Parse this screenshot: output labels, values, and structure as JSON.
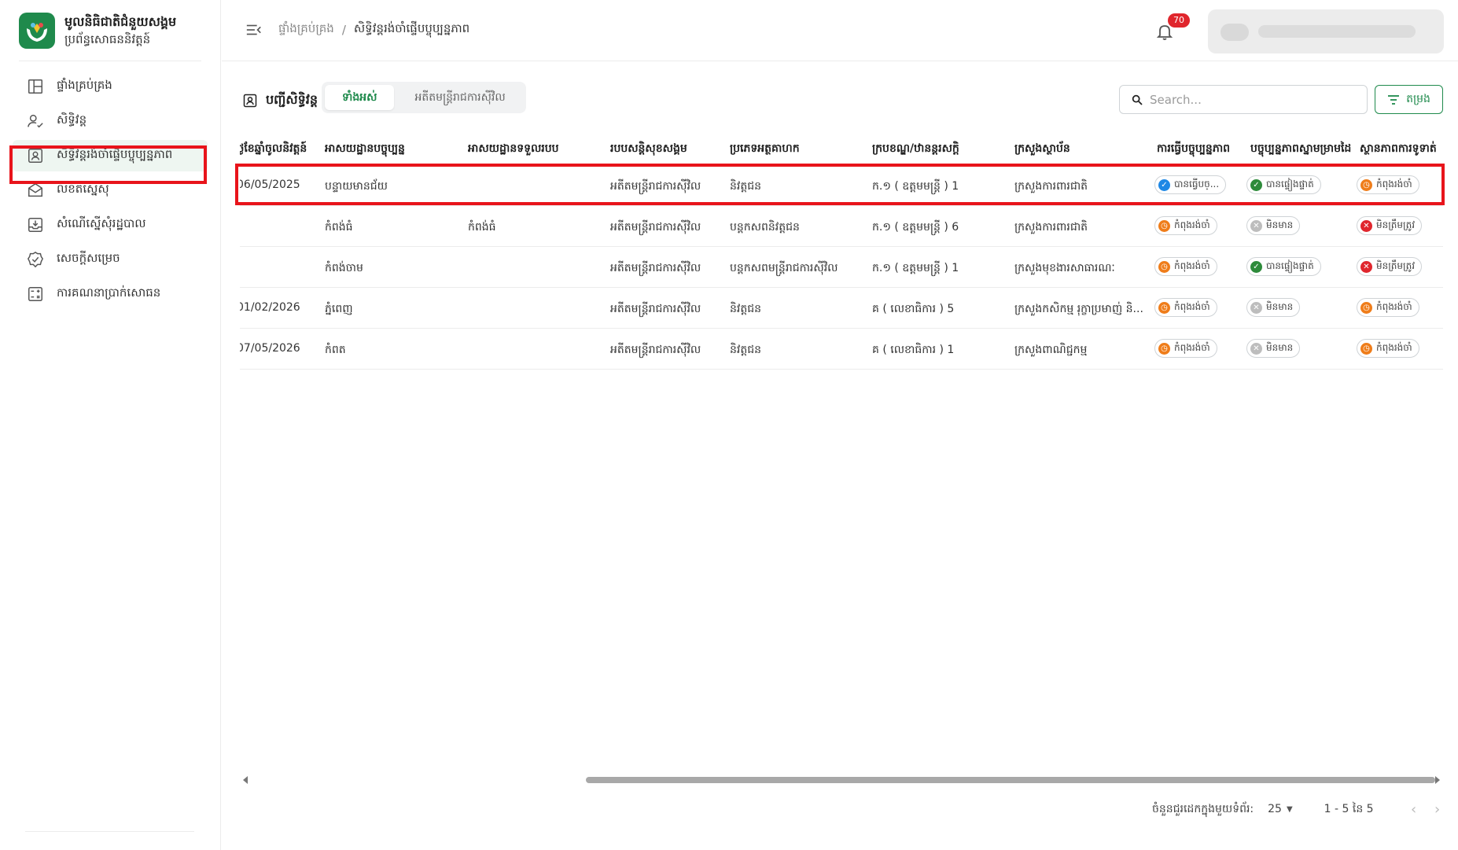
{
  "brand": {
    "title": "មូលនិធិជាតិជំនួយសង្គម",
    "subtitle": "ប្រព័ន្ធសោធននិវត្តន៍"
  },
  "sidebar": {
    "items": [
      {
        "label": "ផ្ទាំងគ្រប់គ្រង",
        "icon": "dashboard-icon"
      },
      {
        "label": "សិទ្ធិវន្ត",
        "icon": "user-check-icon"
      },
      {
        "label": "សិទ្ធិវន្តរង់ចាំផ្ទើបប្ចុប្បន្នភាព",
        "icon": "profile-card-icon"
      },
      {
        "label": "លិខិតស្នើសុំ",
        "icon": "envelope-icon"
      },
      {
        "label": "សំណើស្នើសុំរដ្ឋបាល",
        "icon": "download-tray-icon"
      },
      {
        "label": "សេចក្តីសម្រេច",
        "icon": "verified-badge-icon"
      },
      {
        "label": "ការគណនាប្រាក់សោធន",
        "icon": "calculator-icon"
      }
    ],
    "active_index": 2
  },
  "header": {
    "breadcrumb_home": "ផ្ទាំងគ្រប់គ្រង",
    "breadcrumb_sep": "/",
    "breadcrumb_current": "សិទ្ធិវន្តរង់ចាំផ្ទើបប្ចុប្បន្នភាព",
    "notification_count": "70"
  },
  "toolbar": {
    "list_title": "បញ្ជីសិទ្ធិវន្ត",
    "tabs": [
      "ទាំងអស់",
      "អតីតមន្ត្រីរាជការស៊ីវិល"
    ],
    "active_tab": 0,
    "search_placeholder": "Search...",
    "filter_label": "តម្រង"
  },
  "table": {
    "columns": [
      "ថ្ងៃខែឆ្នាំចូលនិវត្តន៍",
      "អាសយដ្ឋានបច្ចុប្បន្ន",
      "អាសយដ្ឋានទទួលរបប",
      "របបសន្តិសុខសង្គម",
      "ប្រភេទអត្ថគាហក",
      "ក្របខណ្ឌ/ឋានន្តរសក្តិ",
      "ក្រសួងស្ថាប័ន",
      "ការធ្វើបច្ចុប្បន្នភាព",
      "បច្ចុប្បន្នភាពស្នាមម្រាមដៃ",
      "ស្ថានភាពការទូទាត់"
    ],
    "rows": [
      {
        "retire_date": "06/05/2025",
        "current_address": "បន្ទាយមានជ័យ",
        "receive_address": "",
        "scheme": "អតីតមន្ត្រីរាជការស៊ីវិល",
        "type": "និវត្តជន",
        "rank": "ក.១ ( ឧត្តមមន្ត្រី ) 1",
        "ministry": "ក្រសួងការពារជាតិ",
        "update": {
          "label": "បានធ្វើបច្...",
          "status": "blue"
        },
        "fingerprint": {
          "label": "បានផ្ទៀងផ្ទាត់",
          "status": "green"
        },
        "payment": {
          "label": "កំពុងរង់ចាំ",
          "status": "orange"
        }
      },
      {
        "retire_date": "",
        "current_address": "កំពង់ធំ",
        "receive_address": "កំពង់ធំ",
        "scheme": "អតីតមន្ត្រីរាជការស៊ីវិល",
        "type": "បន្តកសពនិវត្តជន",
        "rank": "ក.១ ( ឧត្តមមន្ត្រី ) 6",
        "ministry": "ក្រសួងការពារជាតិ",
        "update": {
          "label": "កំពុងរង់ចាំ",
          "status": "orange"
        },
        "fingerprint": {
          "label": "មិនមាន",
          "status": "gray"
        },
        "payment": {
          "label": "មិនត្រឹមត្រូវ",
          "status": "red"
        }
      },
      {
        "retire_date": "",
        "current_address": "កំពង់ចាម",
        "receive_address": "",
        "scheme": "អតីតមន្ត្រីរាជការស៊ីវិល",
        "type": "បន្តកសពមន្ត្រីរាជការស៊ីវិល",
        "rank": "ក.១ ( ឧត្តមមន្ត្រី ) 1",
        "ministry": "ក្រសួងមុខងារសាធារណៈ",
        "update": {
          "label": "កំពុងរង់ចាំ",
          "status": "orange"
        },
        "fingerprint": {
          "label": "បានផ្ទៀងផ្ទាត់",
          "status": "green"
        },
        "payment": {
          "label": "មិនត្រឹមត្រូវ",
          "status": "red"
        }
      },
      {
        "retire_date": "01/02/2026",
        "current_address": "ភ្នំពេញ",
        "receive_address": "",
        "scheme": "អតីតមន្ត្រីរាជការស៊ីវិល",
        "type": "និវត្តជន",
        "rank": "គ ( លេខាធិការ ) 5",
        "ministry": "ក្រសួងកសិកម្ម រុក្ខាប្រមាញ់ និ...",
        "update": {
          "label": "កំពុងរង់ចាំ",
          "status": "orange"
        },
        "fingerprint": {
          "label": "មិនមាន",
          "status": "gray"
        },
        "payment": {
          "label": "កំពុងរង់ចាំ",
          "status": "orange"
        }
      },
      {
        "retire_date": "07/05/2026",
        "current_address": "កំពត",
        "receive_address": "",
        "scheme": "អតីតមន្ត្រីរាជការស៊ីវិល",
        "type": "និវត្តជន",
        "rank": "គ ( លេខាធិការ ) 1",
        "ministry": "ក្រសួងពាណិជ្ជកម្ម",
        "update": {
          "label": "កំពុងរង់ចាំ",
          "status": "orange"
        },
        "fingerprint": {
          "label": "មិនមាន",
          "status": "gray"
        },
        "payment": {
          "label": "កំពុងរង់ចាំ",
          "status": "orange"
        }
      }
    ]
  },
  "pagination": {
    "rows_per_page_label": "ចំនួនជួរដេកក្នុងមួយទំព័រ:",
    "rows_per_page_value": "25",
    "range_label": "1 - 5 នៃ 5"
  },
  "colors": {
    "brand_green": "#1f8a4c",
    "highlight_red": "#e8141b",
    "status_orange": "#ef7d1a",
    "status_green": "#2e8b3b",
    "status_blue": "#1e88e5",
    "status_red": "#e0262d",
    "status_gray": "#bdbdbd"
  }
}
